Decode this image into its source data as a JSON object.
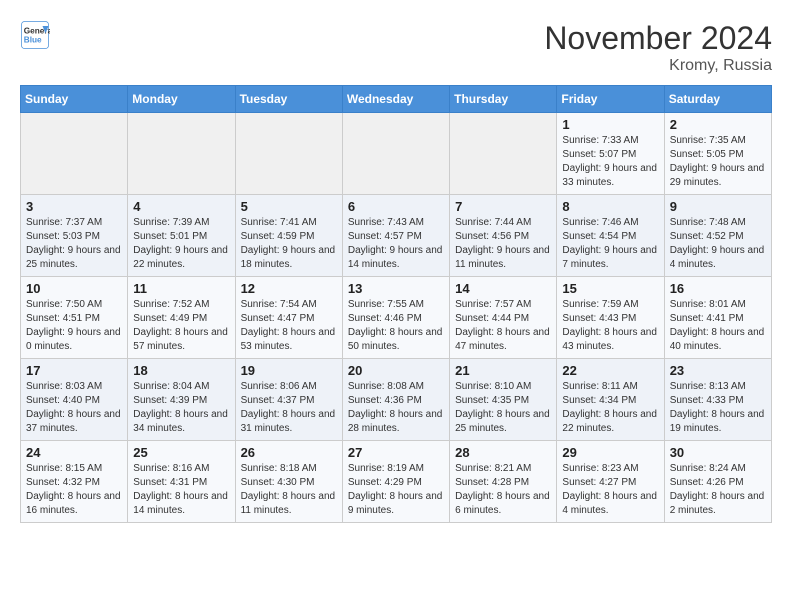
{
  "header": {
    "logo_line1": "General",
    "logo_line2": "Blue",
    "month": "November 2024",
    "location": "Kromy, Russia"
  },
  "weekdays": [
    "Sunday",
    "Monday",
    "Tuesday",
    "Wednesday",
    "Thursday",
    "Friday",
    "Saturday"
  ],
  "weeks": [
    [
      {
        "day": "",
        "info": ""
      },
      {
        "day": "",
        "info": ""
      },
      {
        "day": "",
        "info": ""
      },
      {
        "day": "",
        "info": ""
      },
      {
        "day": "",
        "info": ""
      },
      {
        "day": "1",
        "info": "Sunrise: 7:33 AM\nSunset: 5:07 PM\nDaylight: 9 hours and 33 minutes."
      },
      {
        "day": "2",
        "info": "Sunrise: 7:35 AM\nSunset: 5:05 PM\nDaylight: 9 hours and 29 minutes."
      }
    ],
    [
      {
        "day": "3",
        "info": "Sunrise: 7:37 AM\nSunset: 5:03 PM\nDaylight: 9 hours and 25 minutes."
      },
      {
        "day": "4",
        "info": "Sunrise: 7:39 AM\nSunset: 5:01 PM\nDaylight: 9 hours and 22 minutes."
      },
      {
        "day": "5",
        "info": "Sunrise: 7:41 AM\nSunset: 4:59 PM\nDaylight: 9 hours and 18 minutes."
      },
      {
        "day": "6",
        "info": "Sunrise: 7:43 AM\nSunset: 4:57 PM\nDaylight: 9 hours and 14 minutes."
      },
      {
        "day": "7",
        "info": "Sunrise: 7:44 AM\nSunset: 4:56 PM\nDaylight: 9 hours and 11 minutes."
      },
      {
        "day": "8",
        "info": "Sunrise: 7:46 AM\nSunset: 4:54 PM\nDaylight: 9 hours and 7 minutes."
      },
      {
        "day": "9",
        "info": "Sunrise: 7:48 AM\nSunset: 4:52 PM\nDaylight: 9 hours and 4 minutes."
      }
    ],
    [
      {
        "day": "10",
        "info": "Sunrise: 7:50 AM\nSunset: 4:51 PM\nDaylight: 9 hours and 0 minutes."
      },
      {
        "day": "11",
        "info": "Sunrise: 7:52 AM\nSunset: 4:49 PM\nDaylight: 8 hours and 57 minutes."
      },
      {
        "day": "12",
        "info": "Sunrise: 7:54 AM\nSunset: 4:47 PM\nDaylight: 8 hours and 53 minutes."
      },
      {
        "day": "13",
        "info": "Sunrise: 7:55 AM\nSunset: 4:46 PM\nDaylight: 8 hours and 50 minutes."
      },
      {
        "day": "14",
        "info": "Sunrise: 7:57 AM\nSunset: 4:44 PM\nDaylight: 8 hours and 47 minutes."
      },
      {
        "day": "15",
        "info": "Sunrise: 7:59 AM\nSunset: 4:43 PM\nDaylight: 8 hours and 43 minutes."
      },
      {
        "day": "16",
        "info": "Sunrise: 8:01 AM\nSunset: 4:41 PM\nDaylight: 8 hours and 40 minutes."
      }
    ],
    [
      {
        "day": "17",
        "info": "Sunrise: 8:03 AM\nSunset: 4:40 PM\nDaylight: 8 hours and 37 minutes."
      },
      {
        "day": "18",
        "info": "Sunrise: 8:04 AM\nSunset: 4:39 PM\nDaylight: 8 hours and 34 minutes."
      },
      {
        "day": "19",
        "info": "Sunrise: 8:06 AM\nSunset: 4:37 PM\nDaylight: 8 hours and 31 minutes."
      },
      {
        "day": "20",
        "info": "Sunrise: 8:08 AM\nSunset: 4:36 PM\nDaylight: 8 hours and 28 minutes."
      },
      {
        "day": "21",
        "info": "Sunrise: 8:10 AM\nSunset: 4:35 PM\nDaylight: 8 hours and 25 minutes."
      },
      {
        "day": "22",
        "info": "Sunrise: 8:11 AM\nSunset: 4:34 PM\nDaylight: 8 hours and 22 minutes."
      },
      {
        "day": "23",
        "info": "Sunrise: 8:13 AM\nSunset: 4:33 PM\nDaylight: 8 hours and 19 minutes."
      }
    ],
    [
      {
        "day": "24",
        "info": "Sunrise: 8:15 AM\nSunset: 4:32 PM\nDaylight: 8 hours and 16 minutes."
      },
      {
        "day": "25",
        "info": "Sunrise: 8:16 AM\nSunset: 4:31 PM\nDaylight: 8 hours and 14 minutes."
      },
      {
        "day": "26",
        "info": "Sunrise: 8:18 AM\nSunset: 4:30 PM\nDaylight: 8 hours and 11 minutes."
      },
      {
        "day": "27",
        "info": "Sunrise: 8:19 AM\nSunset: 4:29 PM\nDaylight: 8 hours and 9 minutes."
      },
      {
        "day": "28",
        "info": "Sunrise: 8:21 AM\nSunset: 4:28 PM\nDaylight: 8 hours and 6 minutes."
      },
      {
        "day": "29",
        "info": "Sunrise: 8:23 AM\nSunset: 4:27 PM\nDaylight: 8 hours and 4 minutes."
      },
      {
        "day": "30",
        "info": "Sunrise: 8:24 AM\nSunset: 4:26 PM\nDaylight: 8 hours and 2 minutes."
      }
    ]
  ]
}
